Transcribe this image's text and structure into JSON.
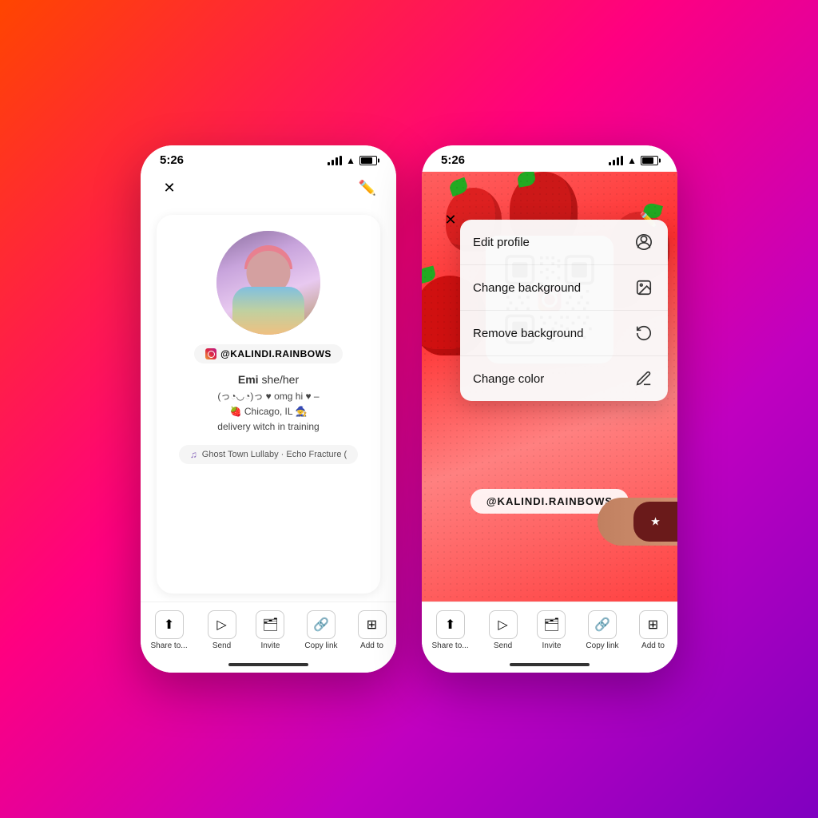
{
  "background": {
    "gradient": "linear-gradient(135deg, #ff4500 0%, #ff0080 40%, #c000c0 70%, #8000c0 100%)"
  },
  "phone1": {
    "status": {
      "time": "5:26"
    },
    "username": "@KALINDI.RAINBOWS",
    "profile": {
      "name": "Emi",
      "pronouns": "she/her",
      "bio_line1": "(っ◔◡◔)っ ♥ omg hi ♥ –",
      "bio_line2": "🍓 Chicago, IL 🧙",
      "bio_line3": "delivery witch in training"
    },
    "music": "Ghost Town Lullaby · Echo Fracture (",
    "actions": [
      {
        "label": "Share to..."
      },
      {
        "label": "Send"
      },
      {
        "label": "Invite"
      },
      {
        "label": "Copy link"
      },
      {
        "label": "Add to"
      }
    ]
  },
  "phone2": {
    "status": {
      "time": "5:26"
    },
    "username": "@KALINDI.RAINBOWS",
    "dropdown": {
      "items": [
        {
          "label": "Edit profile",
          "icon": "person-circle"
        },
        {
          "label": "Change background",
          "icon": "image"
        },
        {
          "label": "Remove background",
          "icon": "undo-circle"
        },
        {
          "label": "Change color",
          "icon": "eyedropper"
        }
      ]
    },
    "actions": [
      {
        "label": "Share to..."
      },
      {
        "label": "Send"
      },
      {
        "label": "Invite"
      },
      {
        "label": "Copy link"
      },
      {
        "label": "Add to"
      }
    ]
  }
}
